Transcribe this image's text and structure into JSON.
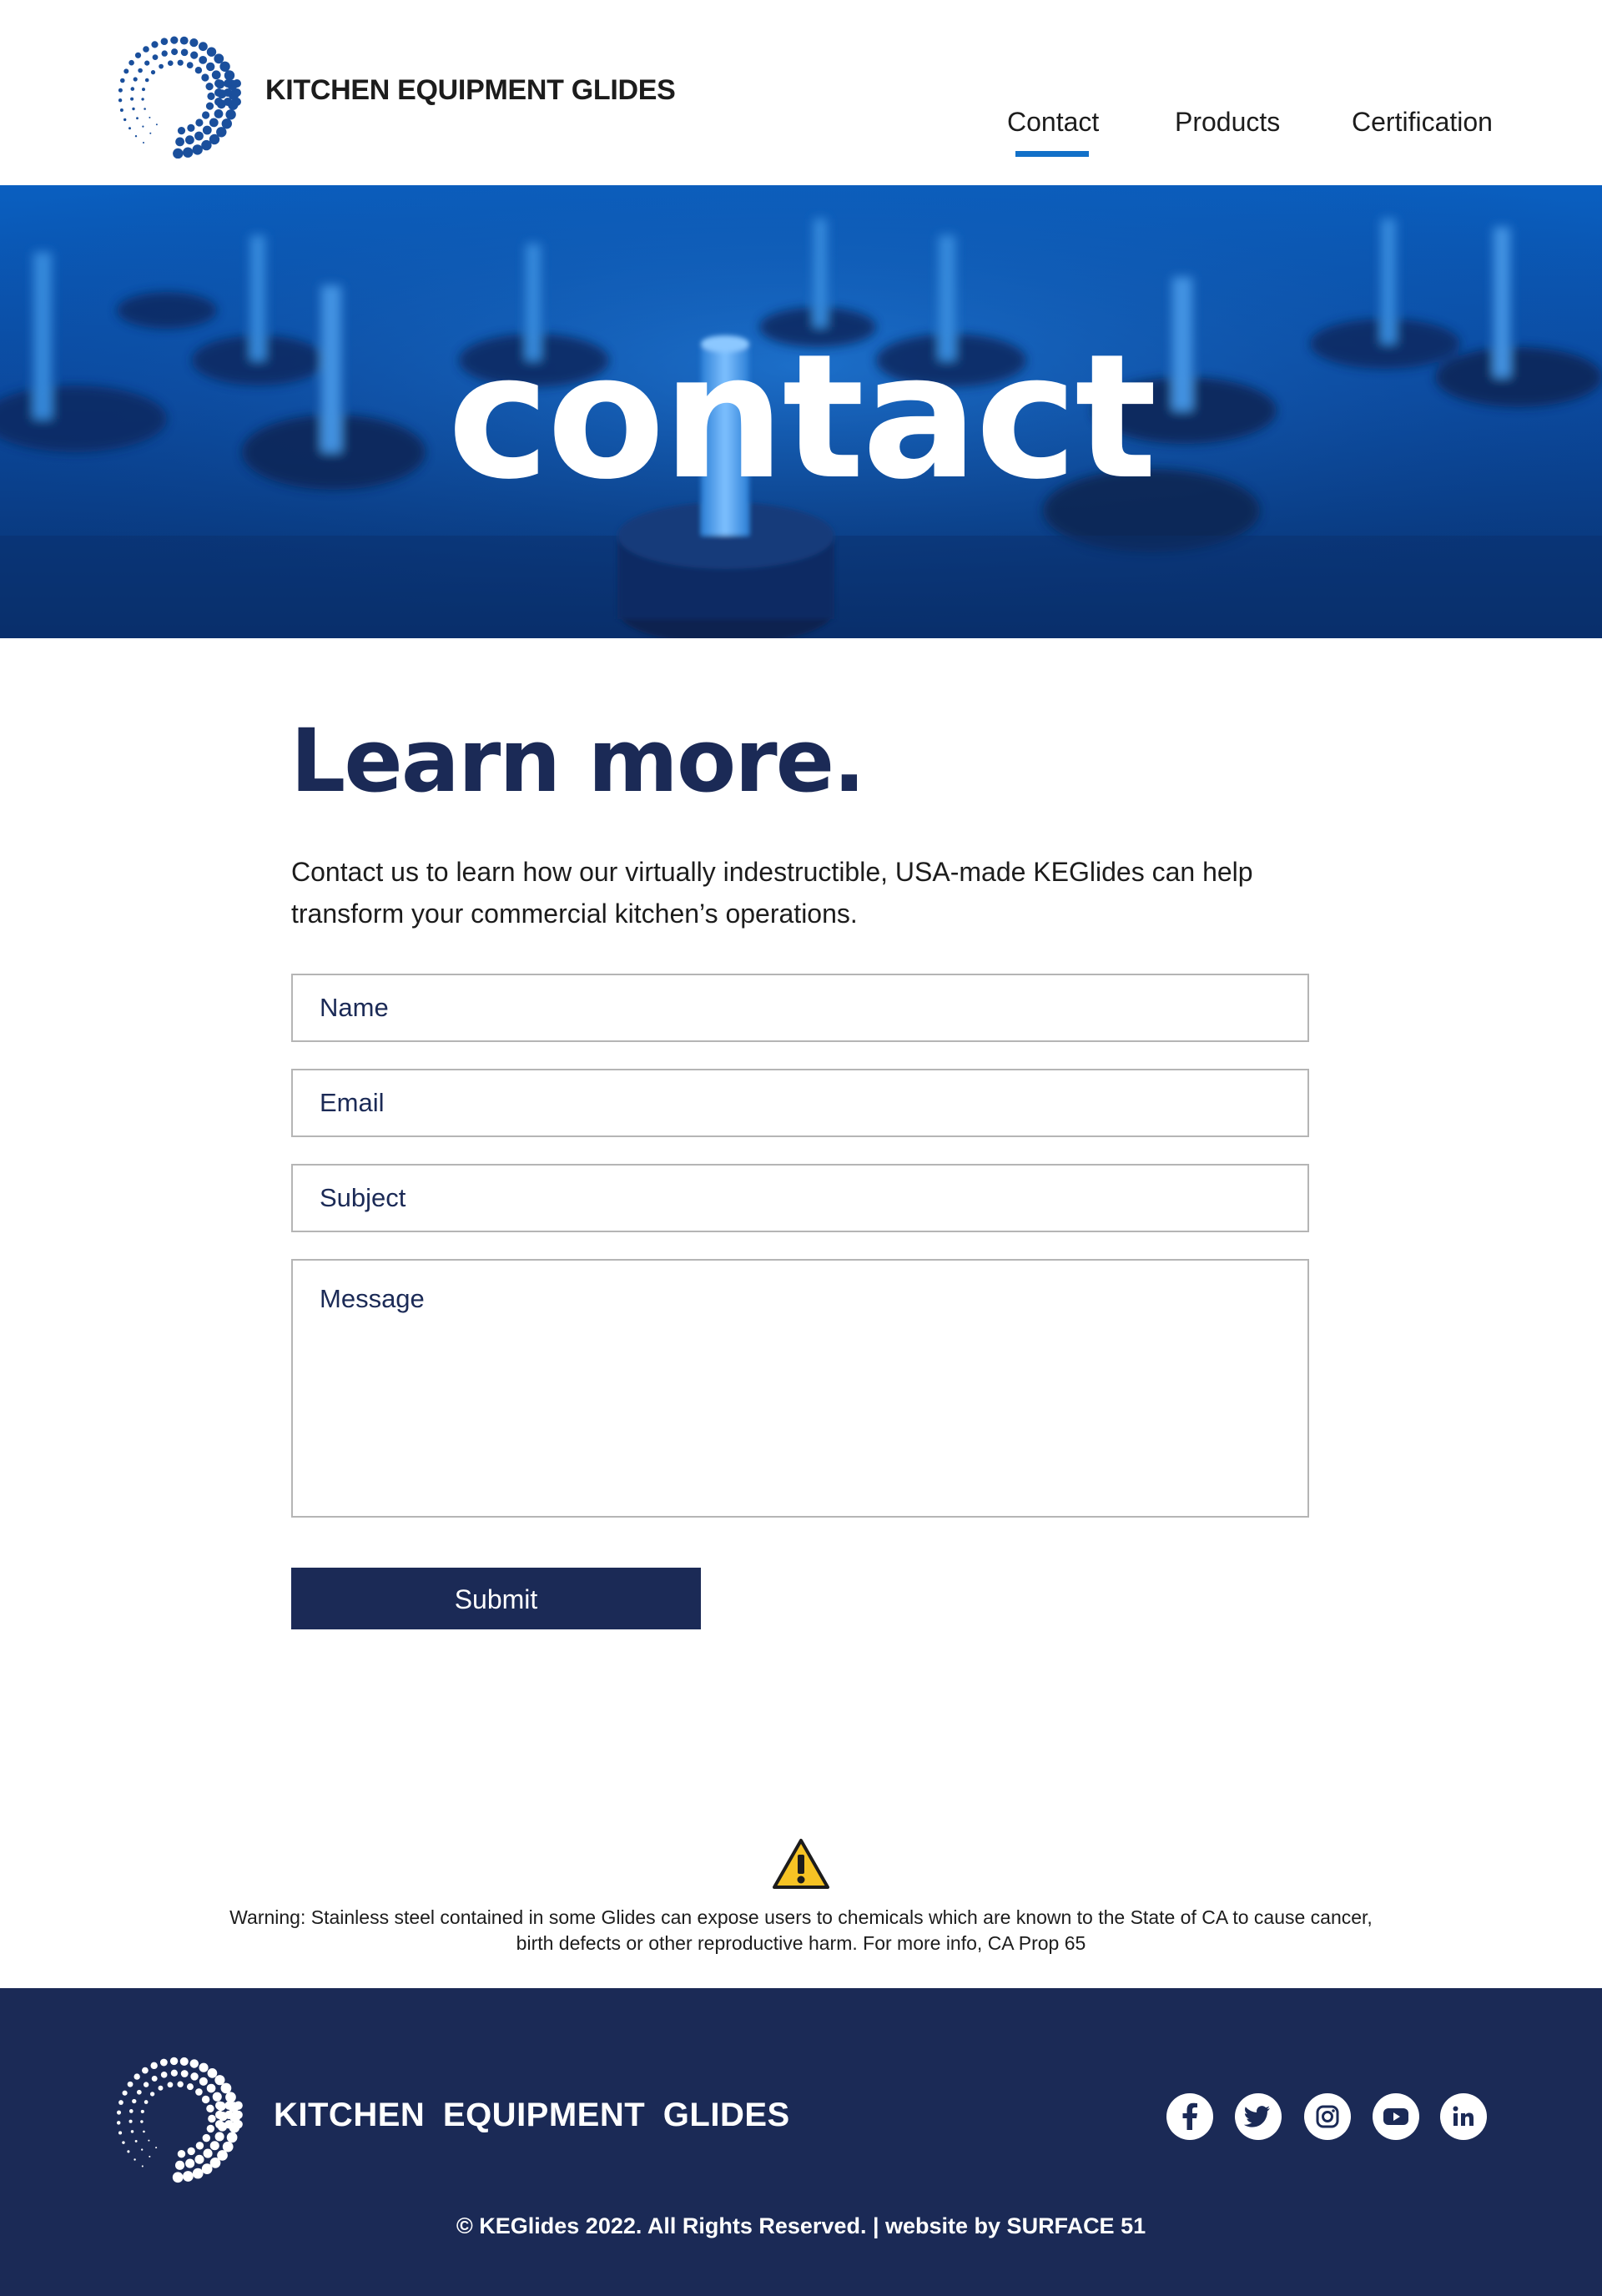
{
  "header": {
    "brand": "KITCHEN EQUIPMENT GLIDES",
    "nav": [
      {
        "label": "Contact",
        "active": true
      },
      {
        "label": "Products",
        "active": false
      },
      {
        "label": "Certification",
        "active": false
      }
    ]
  },
  "hero": {
    "title": "contact"
  },
  "main": {
    "heading": "Learn more.",
    "intro_line1": "Contact us to learn how our virtually indestructible, USA-made KEGlides can help",
    "intro_line2": "transform your commercial kitchen’s operations.",
    "form": {
      "name_placeholder": "Name",
      "email_placeholder": "Email",
      "subject_placeholder": "Subject",
      "message_placeholder": "Message",
      "submit_label": "Submit"
    }
  },
  "warning": {
    "line1": "Warning: Stainless steel contained in some Glides can expose users to chemicals which are known to the State of CA to cause cancer,",
    "line2": "birth defects or other reproductive harm. For more info, CA Prop 65"
  },
  "footer": {
    "brand": "KITCHEN EQUIPMENT GLIDES",
    "social": [
      "facebook-icon",
      "twitter-icon",
      "instagram-icon",
      "youtube-icon",
      "linkedin-icon"
    ],
    "copyright": "© KEGlides 2022. All Rights Reserved. | website by SURFACE 51"
  },
  "colors": {
    "navy": "#1b2a56",
    "accent_blue": "#1270c8",
    "hero_blue": "#0b4aa0",
    "logo_blue": "#1a4f9c"
  }
}
